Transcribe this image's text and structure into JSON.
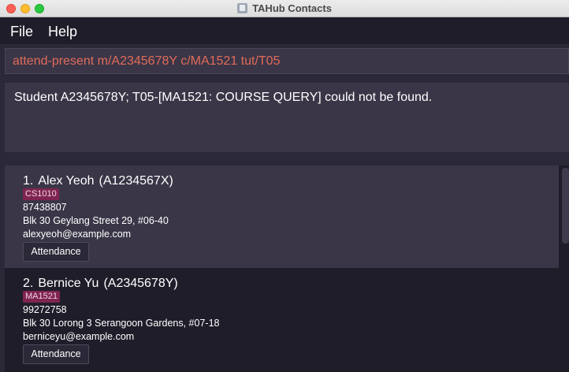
{
  "window": {
    "title": "TAHub Contacts"
  },
  "menu": {
    "file": "File",
    "help": "Help"
  },
  "command": {
    "value": "attend-present m/A2345678Y c/MA1521 tut/T05"
  },
  "result": {
    "message": "Student A2345678Y; T05-[MA1521: COURSE QUERY] could not be found."
  },
  "contacts": [
    {
      "index": "1.",
      "name": "Alex Yeoh",
      "matric": "(A1234567X)",
      "tag": "CS1010",
      "phone": "87438807",
      "address": "Blk 30 Geylang Street 29, #06-40",
      "email": "alexyeoh@example.com",
      "button": "Attendance"
    },
    {
      "index": "2.",
      "name": "Bernice Yu",
      "matric": "(A2345678Y)",
      "tag": "MA1521",
      "phone": "99272758",
      "address": "Blk 30 Lorong 3 Serangoon Gardens, #07-18",
      "email": "berniceyu@example.com",
      "button": "Attendance"
    }
  ],
  "colors": {
    "accent_error": "#e26b5a",
    "tag_bg": "#7f2450",
    "background": "#2b2837"
  }
}
